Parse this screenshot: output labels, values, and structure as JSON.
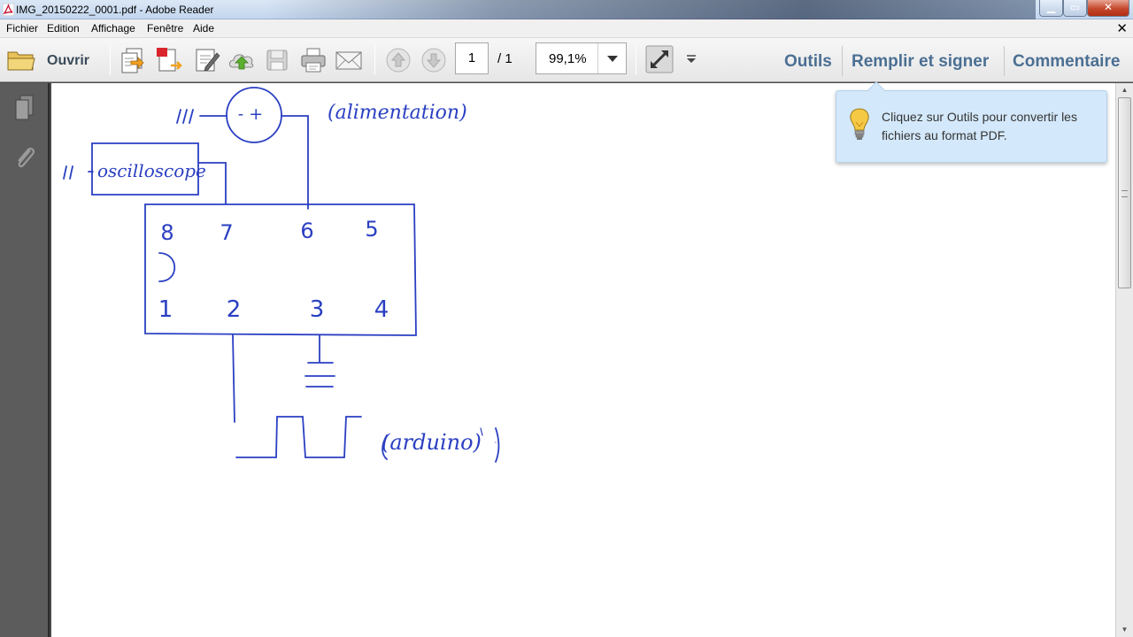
{
  "window": {
    "title": "IMG_20150222_0001.pdf - Adobe Reader",
    "close_glyph": "✕",
    "min_glyph": "▁",
    "max_glyph": "▭"
  },
  "menu": {
    "items": [
      "Fichier",
      "Edition",
      "Affichage",
      "Fenêtre",
      "Aide"
    ],
    "close_glyph": "✕"
  },
  "toolbar": {
    "open_label": "Ouvrir",
    "page_current": "1",
    "page_total": "/ 1",
    "zoom": "99,1%",
    "tools_label": "Outils",
    "fill_sign_label": "Remplir et signer",
    "comment_label": "Commentaire"
  },
  "tooltip": {
    "text": "Cliquez sur Outils pour convertir les fichiers au format PDF."
  },
  "document": {
    "handwritten": {
      "power_label": "(alimentation)",
      "oscillator_label": "oscilloscope",
      "arduino_label": "(arduino)",
      "pins_top": [
        "8",
        "7",
        "6",
        "5"
      ],
      "pins_bottom": [
        "1",
        "2",
        "3",
        "4"
      ],
      "polarity": "- +"
    }
  },
  "colors": {
    "ink": "#2a3fc2",
    "link": "#4b6f93",
    "tooltip_bg": "#d3e8fa"
  }
}
